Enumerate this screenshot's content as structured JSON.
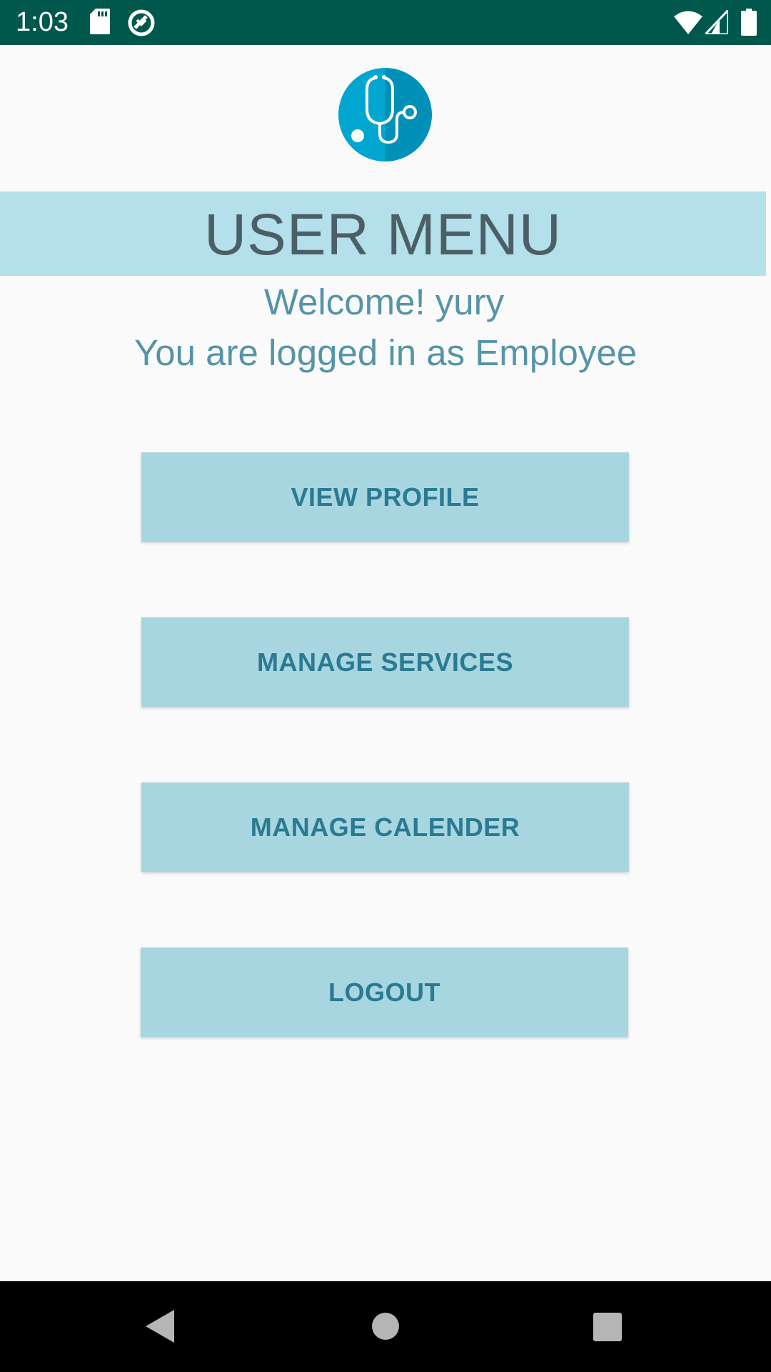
{
  "status_bar": {
    "time": "1:03",
    "icons": [
      "sd-card-icon",
      "sync-icon",
      "wifi-icon",
      "signal-icon",
      "battery-icon"
    ]
  },
  "logo": {
    "icon": "stethoscope-icon",
    "color": "#00a6cf"
  },
  "header": {
    "title": "USER MENU"
  },
  "welcome": {
    "line1": "Welcome! yury",
    "line2": "You are logged in as Employee"
  },
  "buttons": {
    "view_profile": "VIEW PROFILE",
    "manage_services": "MANAGE SERVICES",
    "manage_calender": "MANAGE CALENDER",
    "logout": "LOGOUT"
  },
  "nav_bar": {
    "icons": [
      "back-icon",
      "home-icon",
      "recents-icon"
    ]
  },
  "colors": {
    "status_bar": "#00584d",
    "header_band": "#b3e0ea",
    "button_bg": "#a8d6e0",
    "button_text": "#2a7a92",
    "welcome_text": "#5694a8",
    "title_text": "#4d5f66"
  }
}
